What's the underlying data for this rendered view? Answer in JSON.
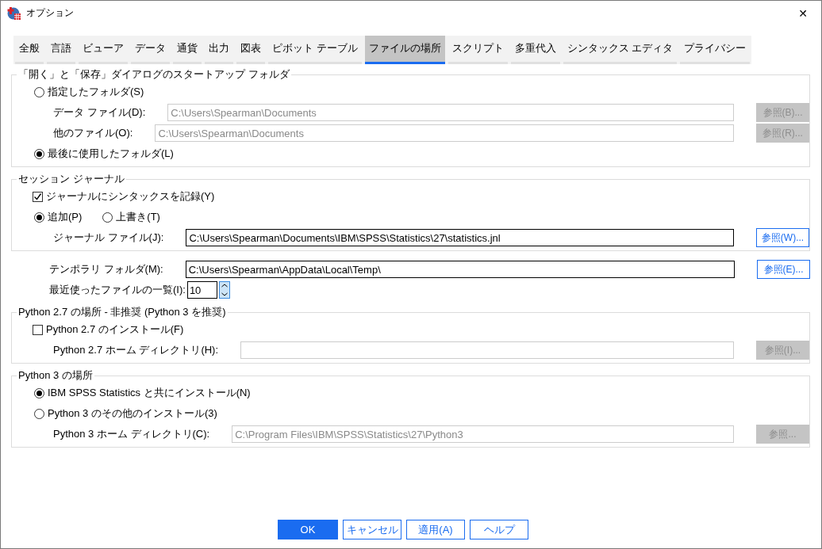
{
  "window": {
    "title": "オプション",
    "close": "✕"
  },
  "tabs": [
    {
      "label": "全般",
      "selected": false
    },
    {
      "label": "言語",
      "selected": false
    },
    {
      "label": "ビューア",
      "selected": false
    },
    {
      "label": "データ",
      "selected": false
    },
    {
      "label": "通貨",
      "selected": false
    },
    {
      "label": "出力",
      "selected": false
    },
    {
      "label": "図表",
      "selected": false
    },
    {
      "label": "ピボット テーブル",
      "selected": false
    },
    {
      "label": "ファイルの場所",
      "selected": true
    },
    {
      "label": "スクリプト",
      "selected": false
    },
    {
      "label": "多重代入",
      "selected": false
    },
    {
      "label": "シンタックス エディタ",
      "selected": false
    },
    {
      "label": "プライバシー",
      "selected": false
    }
  ],
  "groups": [
    {
      "kind": "frame",
      "title": "「開く」と「保存」ダイアログのスタートアップ フォルダ",
      "rows": [
        {
          "kind": "radio",
          "label": "指定したフォルダ(S)",
          "selected": false
        },
        {
          "kind": "field",
          "label": "データ ファイル(D):",
          "value": "C:\\Users\\Spearman\\Documents",
          "disabled": true,
          "button": "参照(B)..."
        },
        {
          "kind": "field",
          "label": "他のファイル(O):",
          "value": "C:\\Users\\Spearman\\Documents",
          "disabled": true,
          "button": "参照(R)..."
        },
        {
          "kind": "radio",
          "label": "最後に使用したフォルダ(L)",
          "selected": true
        }
      ]
    },
    {
      "kind": "frame",
      "title": "セッション ジャーナル",
      "rows": [
        {
          "kind": "checkbox",
          "label": "ジャーナルにシンタックスを記録(Y)",
          "checked": true
        },
        {
          "kind": "radios",
          "options": [
            {
              "label": "追加(P)",
              "selected": true
            },
            {
              "label": "上書き(T)",
              "selected": false
            }
          ]
        },
        {
          "kind": "field",
          "label": "ジャーナル ファイル(J):",
          "value": "C:\\Users\\Spearman\\Documents\\IBM\\SPSS\\Statistics\\27\\statistics.jnl",
          "disabled": false,
          "button": "参照(W)..."
        }
      ]
    },
    {
      "kind": "plain",
      "rows": [
        {
          "kind": "field",
          "label": "テンポラリ フォルダ(M):",
          "value": "C:\\Users\\Spearman\\AppData\\Local\\Temp\\",
          "disabled": false,
          "button": "参照(E)..."
        },
        {
          "kind": "spinner",
          "label": "最近使ったファイルの一覧(I):",
          "value": "10"
        }
      ]
    },
    {
      "kind": "frame",
      "title": "Python 2.7 の場所 - 非推奨 (Python 3 を推奨)",
      "rows": [
        {
          "kind": "checkbox",
          "label": "Python 2.7 のインストール(F)",
          "checked": false
        },
        {
          "kind": "field",
          "label": "Python 2.7 ホーム ディレクトリ(H):",
          "value": "",
          "disabled": true,
          "button": "参照(I)..."
        }
      ]
    },
    {
      "kind": "frame",
      "title": "Python 3 の場所",
      "rows": [
        {
          "kind": "radio",
          "label": "IBM SPSS Statistics と共にインストール(N)",
          "selected": true
        },
        {
          "kind": "radio",
          "label": "Python 3 のその他のインストール(3)",
          "selected": false
        },
        {
          "kind": "field",
          "label": "Python 3 ホーム ディレクトリ(C):",
          "value": "C:\\Program Files\\IBM\\SPSS\\Statistics\\27\\Python3",
          "disabled": true,
          "button": "参照..."
        }
      ]
    }
  ],
  "buttons": [
    {
      "label": "OK",
      "default": true
    },
    {
      "label": "キャンセル",
      "default": false
    },
    {
      "label": "適用(A)",
      "default": false
    },
    {
      "label": "ヘルプ",
      "default": false
    }
  ]
}
